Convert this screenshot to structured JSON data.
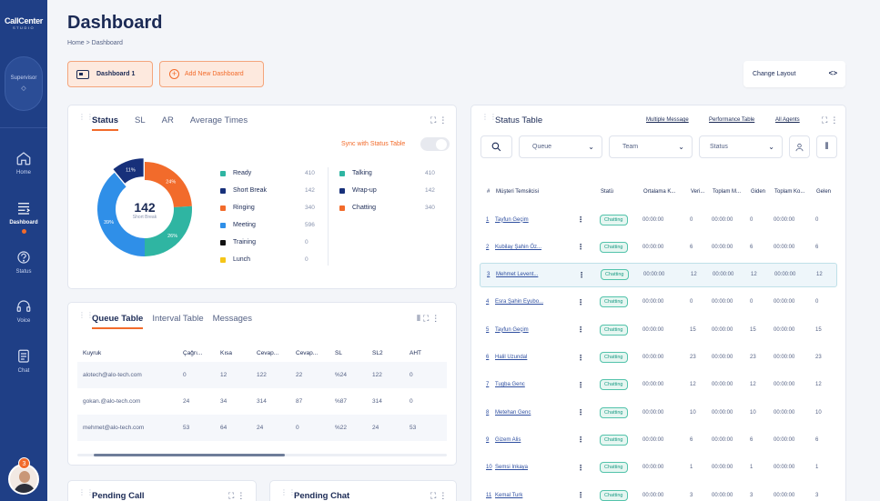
{
  "brand": {
    "logo_text": "CallCenter",
    "logo_sub": "STUDIO"
  },
  "sidebar": {
    "role": "Supervisor",
    "items": [
      {
        "label": "Home",
        "icon": "home-icon"
      },
      {
        "label": "Dashboard",
        "icon": "dashboard-icon",
        "active": true
      },
      {
        "label": "Status",
        "icon": "status-icon"
      },
      {
        "label": "Voice",
        "icon": "headset-icon"
      },
      {
        "label": "Chat",
        "icon": "chat-icon"
      }
    ],
    "notification_count": "3"
  },
  "header": {
    "title": "Dashboard",
    "breadcrumb": "Home > Dashboard"
  },
  "dashboard_tabs": {
    "current": "Dashboard 1",
    "add": "Add New Dashboard",
    "change_layout": "Change Layout"
  },
  "status_card": {
    "tabs": [
      "Status",
      "SL",
      "AR",
      "Average Times"
    ],
    "sync_label": "Sync with Status Table",
    "center_value": "142",
    "center_label": "Short Break",
    "slice_labels": [
      "24%",
      "26%",
      "39%",
      "11%"
    ],
    "legend_left": [
      {
        "label": "Ready",
        "value": "410",
        "color": "#2fb5a2"
      },
      {
        "label": "Short Break",
        "value": "142",
        "color": "#17307a"
      },
      {
        "label": "Ringing",
        "value": "340",
        "color": "#f26b2b"
      },
      {
        "label": "Meeting",
        "value": "596",
        "color": "#2f8fe8"
      },
      {
        "label": "Training",
        "value": "0",
        "color": "#111111"
      },
      {
        "label": "Lunch",
        "value": "0",
        "color": "#f5c518"
      }
    ],
    "legend_right": [
      {
        "label": "Talking",
        "value": "410",
        "color": "#2fb5a2"
      },
      {
        "label": "Wrap-up",
        "value": "142",
        "color": "#17307a"
      },
      {
        "label": "Chatting",
        "value": "340",
        "color": "#f26b2b"
      }
    ]
  },
  "chart_data": {
    "type": "pie",
    "categories": [
      "Ringing",
      "Ready",
      "Meeting",
      "Short Break"
    ],
    "values": [
      24,
      26,
      39,
      11
    ],
    "colors": [
      "#f26b2b",
      "#2fb5a2",
      "#2f8fe8",
      "#17307a"
    ],
    "center_value": "142",
    "center_label": "Short Break"
  },
  "queue_card": {
    "tabs": [
      "Queue Table",
      "Interval Table",
      "Messages"
    ],
    "headers": [
      "Kuyruk",
      "Çağrı...",
      "Kısa",
      "Cevap...",
      "Cevap...",
      "SL",
      "SL2",
      "AHT"
    ],
    "rows": [
      [
        "alotech@alo-tech.com",
        "0",
        "12",
        "122",
        "22",
        "%24",
        "122",
        "0"
      ],
      [
        "gokan.@alo-tech.com",
        "24",
        "34",
        "314",
        "87",
        "%87",
        "314",
        "0"
      ],
      [
        "mehmet@alo-tech.com",
        "53",
        "64",
        "24",
        "0",
        "%22",
        "24",
        "53"
      ]
    ]
  },
  "status_table": {
    "title": "Status Table",
    "links": [
      "Multiple Message",
      "Performance Table",
      "All Agents"
    ],
    "filters": [
      "Queue",
      "Team",
      "Status"
    ],
    "headers": [
      "#",
      "Müşteri Temsilcisi",
      "Statü",
      "Ortalama K...",
      "Veri...",
      "Toplam M...",
      "Giden",
      "Toplam Ko...",
      "Gelen"
    ],
    "rows": [
      [
        "1",
        "Tayfun Geçim",
        "Chatting",
        "00:00:00",
        "0",
        "00:00:00",
        "0",
        "00:00:00",
        "0"
      ],
      [
        "2",
        "Kubilay Şahin Öz...",
        "Chatting",
        "00:00:00",
        "6",
        "00:00:00",
        "6",
        "00:00:00",
        "6"
      ],
      [
        "3",
        "Mehmet Levent...",
        "Chatting",
        "00:00:00",
        "12",
        "00:00:00",
        "12",
        "00:00:00",
        "12"
      ],
      [
        "4",
        "Esra Şahin Eyubo...",
        "Chatting",
        "00:00:00",
        "0",
        "00:00:00",
        "0",
        "00:00:00",
        "0"
      ],
      [
        "5",
        "Tayfun Geçim",
        "Chatting",
        "00:00:00",
        "15",
        "00:00:00",
        "15",
        "00:00:00",
        "15"
      ],
      [
        "6",
        "Halil Uzundal",
        "Chatting",
        "00:00:00",
        "23",
        "00:00:00",
        "23",
        "00:00:00",
        "23"
      ],
      [
        "7",
        "Tugba Genc",
        "Chatting",
        "00:00:00",
        "12",
        "00:00:00",
        "12",
        "00:00:00",
        "12"
      ],
      [
        "8",
        "Metehan Genc",
        "Chatting",
        "00:00:00",
        "10",
        "00:00:00",
        "10",
        "00:00:00",
        "10"
      ],
      [
        "9",
        "Gizem Alis",
        "Chatting",
        "00:00:00",
        "6",
        "00:00:00",
        "6",
        "00:00:00",
        "6"
      ],
      [
        "10",
        "Semsi Inkaya",
        "Chatting",
        "00:00:00",
        "1",
        "00:00:00",
        "1",
        "00:00:00",
        "1"
      ],
      [
        "11",
        "Kemal Turk",
        "Chatting",
        "00:00:00",
        "3",
        "00:00:00",
        "3",
        "00:00:00",
        "3"
      ]
    ]
  },
  "bottom_cards": {
    "pending_call": "Pending Call",
    "pending_chat": "Pending Chat"
  }
}
